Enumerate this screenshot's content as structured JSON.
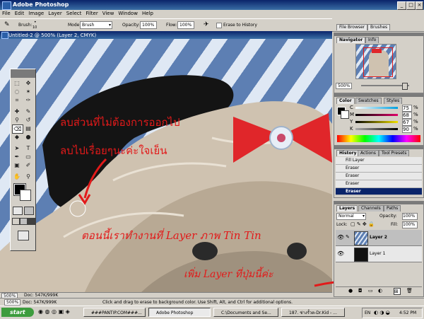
{
  "window": {
    "title": "Adobe Photoshop"
  },
  "menu": [
    "File",
    "Edit",
    "Image",
    "Layer",
    "Select",
    "Filter",
    "View",
    "Window",
    "Help"
  ],
  "options": {
    "brush_label": "Brush:",
    "brush_size": "10",
    "mode_label": "Mode:",
    "mode_value": "Brush",
    "opacity_label": "Opacity:",
    "opacity_value": "100%",
    "flow_label": "Flow:",
    "flow_value": "100%",
    "erase_history_label": "Erase to History"
  },
  "well": {
    "file_browser": "File Browser",
    "brushes": "Brushes"
  },
  "document": {
    "title": "Untitled-2 @ 500% (Layer 2, CMYK)",
    "zoom": "500%",
    "doc_info": "Doc: 547K/999K"
  },
  "annotations": {
    "line1": "ลบส่วนที่ไม่ต้องการออกไป",
    "line2": "ลบไปเรื่อยๆนะค่ะใจเย็น",
    "line3": "ตอนนี้เราทำงานที่ Layer ภาพ Tin Tin",
    "line4": "เพิ่ม Layer ที่ปุ่มนี้ค่ะ"
  },
  "navigator": {
    "tabs": [
      "Navigator",
      "Info"
    ],
    "zoom": "500%"
  },
  "color": {
    "tabs": [
      "Color",
      "Swatches",
      "Styles"
    ],
    "channels": [
      {
        "label": "C",
        "value": "75",
        "pct": "%"
      },
      {
        "label": "M",
        "value": "68",
        "pct": "%"
      },
      {
        "label": "Y",
        "value": "67",
        "pct": "%"
      },
      {
        "label": "K",
        "value": "90",
        "pct": "%"
      }
    ]
  },
  "history": {
    "tabs": [
      "History",
      "Actions",
      "Tool Presets"
    ],
    "items": [
      "Fill Layer",
      "Eraser",
      "Eraser",
      "Eraser",
      "Eraser"
    ]
  },
  "layers": {
    "tabs": [
      "Layers",
      "Channels",
      "Paths"
    ],
    "blend": "Normal",
    "opacity_label": "Opacity:",
    "opacity": "100%",
    "lock_label": "Lock:",
    "fill_label": "Fill:",
    "fill": "100%",
    "items": [
      "Layer 2",
      "Layer 1"
    ]
  },
  "statusbar": {
    "hint": "Click and drag to erase to background color. Use Shift, Alt, and Ctrl for additional options."
  },
  "taskbar": {
    "start": "start",
    "buttons": [
      "###PANTIP.COM###...",
      "Adobe Photoshop",
      "C:\\Documents and Se...",
      "187. ช่างรั้วต-Dr.Kid - ..."
    ],
    "lang": "EN",
    "time": "4:52 PM"
  },
  "colors": {
    "accent_red": "#e21a1a",
    "title_blue": "#0a246a"
  }
}
